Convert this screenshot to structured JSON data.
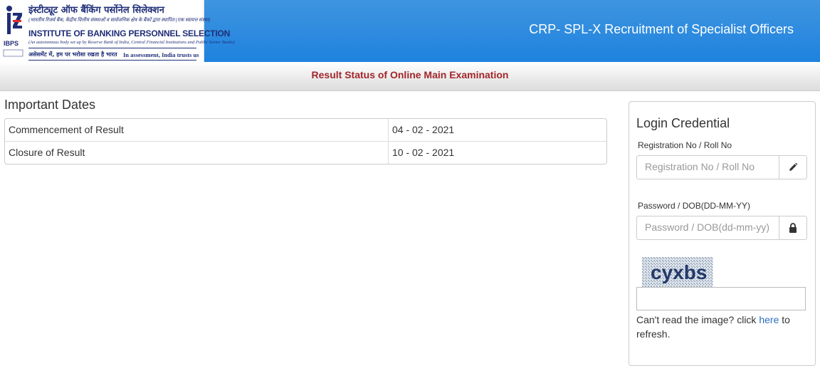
{
  "header": {
    "logo": {
      "hindi_name": "इंस्टीट्यूट ऑफ बैंकिंग पर्सोनेल सिलेक्शन",
      "hindi_subtitle": "(भारतीय रिजर्व बैंक, केंद्रीय वित्तीय संस्थाओं व सार्वजनिक क्षेत्र के बैंकों द्वारा स्थापित (एक स्वायत्त संस्था)",
      "english_name": "INSTITUTE OF BANKING PERSONNEL SELECTION",
      "english_subtitle": "(An autonomous body set up by Reserve Bank of India, Central Financial Institutions and Public Sector Banks)",
      "motto_hindi": "असेसमेंट में, हम पर भरोसा रखता है भारत",
      "motto_english": "In assessment, India trusts us",
      "acronym": "IBPS"
    },
    "title": "CRP- SPL-X Recruitment of Specialist Officers"
  },
  "subheader": {
    "title": "Result Status of Online Main Examination"
  },
  "important_dates": {
    "heading": "Important Dates",
    "rows": [
      {
        "label": "Commencement of Result",
        "value": "04 - 02 - 2021"
      },
      {
        "label": "Closure of Result",
        "value": "10 - 02 - 2021"
      }
    ]
  },
  "login": {
    "title": "Login Credential",
    "registration_label": "Registration No / Roll No",
    "registration_placeholder": "Registration No / Roll No",
    "password_label": "Password / DOB(DD-MM-YY)",
    "password_placeholder": "Password / DOB(dd-mm-yy)",
    "captcha_text": "cyxbs",
    "captcha_help_prefix": "Can't read the image? click ",
    "captcha_help_link": "here",
    "captcha_help_suffix": " to refresh."
  },
  "colors": {
    "header_blue": "#1e82df",
    "subheader_text": "#a3262a",
    "logo_navy": "#1f2e78",
    "link": "#2a6fc0"
  }
}
